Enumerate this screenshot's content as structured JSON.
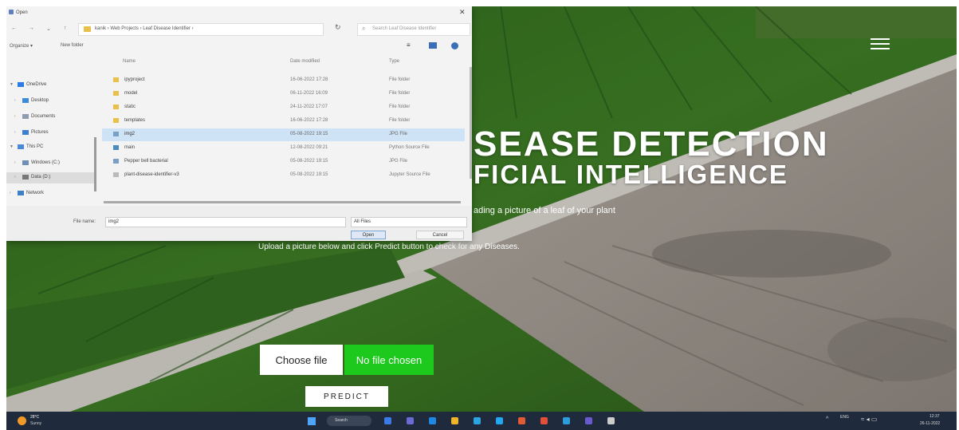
{
  "page": {
    "heading_line1": "SEASE DETECTION",
    "heading_line2": "FICIAL INTELLIGENCE",
    "subtitle": "ading a picture of a leaf of your plant",
    "instruction": "Upload a picture below and click Predict button to check for any Diseases.",
    "choose_file_label": "Choose file",
    "no_file_label": "No file chosen",
    "predict_label": "PREDICT",
    "menu_icon": "hamburger-icon",
    "accent_color": "#1ec91e"
  },
  "dialog": {
    "title": "Open",
    "breadcrumb": "kanik  ›  Web Projects  ›  Leaf Disease Identifier  ›",
    "search_placeholder": "Search Leaf Disease Identifier",
    "organize_label": "Organize ▾",
    "new_folder_label": "New folder",
    "nav_items": [
      {
        "label": "OneDrive",
        "expanded": true
      },
      {
        "label": "Desktop",
        "expanded": false
      },
      {
        "label": "Documents",
        "expanded": false
      },
      {
        "label": "Pictures",
        "expanded": false
      },
      {
        "label": "This PC",
        "expanded": true
      },
      {
        "label": "Windows (C:)",
        "expanded": false
      },
      {
        "label": "Data (D:)",
        "expanded": false,
        "selected": true
      },
      {
        "label": "Network",
        "expanded": false
      }
    ],
    "columns": {
      "name": "Name",
      "date": "Date modified",
      "type": "Type"
    },
    "files": [
      {
        "name": "ipyproject",
        "date": "16-06-2022 17:28",
        "type": "File folder",
        "selected": false
      },
      {
        "name": "model",
        "date": "06-11-2022 16:09",
        "type": "File folder",
        "selected": false
      },
      {
        "name": "static",
        "date": "24-11-2022 17:07",
        "type": "File folder",
        "selected": false
      },
      {
        "name": "templates",
        "date": "16-06-2022 17:28",
        "type": "File folder",
        "selected": false
      },
      {
        "name": "img2",
        "date": "05-08-2022 19:15",
        "type": "JPG File",
        "selected": true
      },
      {
        "name": "main",
        "date": "12-08-2022 09:21",
        "type": "Python Source File",
        "selected": false
      },
      {
        "name": "Pepper bell bacterial",
        "date": "05-08-2022 19:15",
        "type": "JPG File",
        "selected": false
      },
      {
        "name": "plant-disease-identifier-v3",
        "date": "05-08-2022 19:15",
        "type": "Jupyter Source File",
        "selected": false
      }
    ],
    "file_name_label": "File name:",
    "file_name_value": "img2",
    "file_type_value": "All Files",
    "open_label": "Open",
    "cancel_label": "Cancel"
  },
  "taskbar": {
    "weather_temp": "28°C",
    "weather_condition": "Sunny",
    "search_label": "Search",
    "lang": "ENG",
    "lang_sub": "IN",
    "time": "12:37",
    "date": "26-11-2022",
    "app_colors": [
      "#3b7be8",
      "#6b6bd6",
      "#1e88e5",
      "#f0b429",
      "#2ba4e0",
      "#22a7f0",
      "#e35b34",
      "#e3503a",
      "#2d9cdb",
      "#6a5acd",
      "#cccccc"
    ]
  }
}
